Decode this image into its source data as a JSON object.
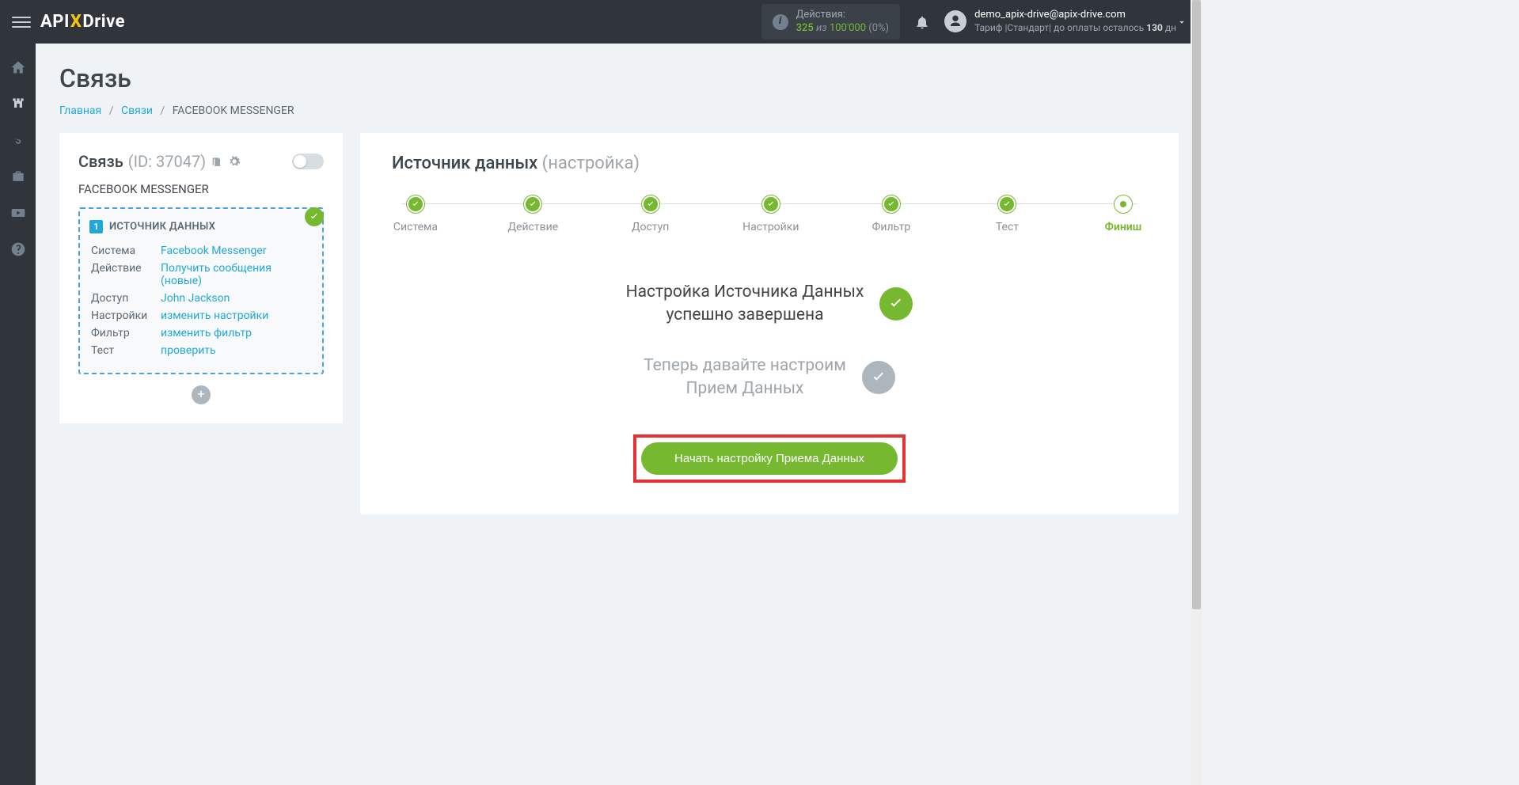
{
  "header": {
    "logo_prefix": "API",
    "logo_x": "X",
    "logo_suffix": "Drive",
    "actions": {
      "label": "Действия:",
      "used": "325",
      "iz": "из",
      "max": "100'000",
      "pct": "(0%)"
    },
    "user": {
      "email": "demo_apix-drive@apix-drive.com",
      "tariff_prefix": "Тариф |Стандарт| до оплаты осталось ",
      "tariff_days": "130",
      "tariff_suffix": " дн"
    }
  },
  "page": {
    "title": "Связь",
    "breadcrumb": {
      "home": "Главная",
      "links": "Связи",
      "current": "FACEBOOK MESSENGER"
    }
  },
  "left_card": {
    "title": "Связь",
    "id_label": "(ID: 37047)",
    "name": "FACEBOOK MESSENGER",
    "source_block": {
      "badge_num": "1",
      "title": "ИСТОЧНИК ДАННЫХ",
      "rows": [
        {
          "label": "Система",
          "value": "Facebook Messenger"
        },
        {
          "label": "Действие",
          "value": "Получить сообщения (новые)"
        },
        {
          "label": "Доступ",
          "value": "John Jackson"
        },
        {
          "label": "Настройки",
          "value": "изменить настройки"
        },
        {
          "label": "Фильтр",
          "value": "изменить фильтр"
        },
        {
          "label": "Тест",
          "value": "проверить"
        }
      ]
    }
  },
  "right_card": {
    "title": "Источник данных",
    "subtitle": "(настройка)",
    "steps": [
      {
        "label": "Система",
        "state": "done"
      },
      {
        "label": "Действие",
        "state": "done"
      },
      {
        "label": "Доступ",
        "state": "done"
      },
      {
        "label": "Настройки",
        "state": "done"
      },
      {
        "label": "Фильтр",
        "state": "done"
      },
      {
        "label": "Тест",
        "state": "done"
      },
      {
        "label": "Финиш",
        "state": "current"
      }
    ],
    "success1_line1": "Настройка Источника Данных",
    "success1_line2": "успешно завершена",
    "success2_line1": "Теперь давайте настроим",
    "success2_line2": "Прием Данных",
    "cta": "Начать настройку Приема Данных"
  }
}
